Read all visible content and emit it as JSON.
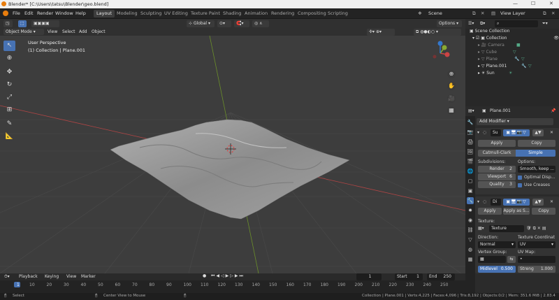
{
  "window": {
    "title": "Blender* [C:\\Users\\tatsu\\Blender\\geo.blend]",
    "min": "—",
    "max": "☐",
    "close": "✕"
  },
  "topbar": {
    "menus": [
      "File",
      "Edit",
      "Render",
      "Window",
      "Help"
    ],
    "workspaces": [
      "Layout",
      "Modeling",
      "Sculpting",
      "UV Editing",
      "Texture Paint",
      "Shading",
      "Animation",
      "Rendering",
      "Compositing",
      "Scripting"
    ],
    "active_workspace": "Layout",
    "scene": "Scene",
    "view_layer": "View Layer"
  },
  "viewport_header": {
    "mode": "Object Mode",
    "menus": [
      "View",
      "Select",
      "Add",
      "Object"
    ],
    "transform": "Global",
    "options": "Options"
  },
  "viewport": {
    "perspective": "User Perspective",
    "collection": "(1) Collection | Plane.001"
  },
  "outliner": {
    "rows": [
      {
        "label": "Scene Collection",
        "dim": false
      },
      {
        "label": "Collection",
        "dim": false
      },
      {
        "label": "Camera",
        "dim": true
      },
      {
        "label": "Cube",
        "dim": true
      },
      {
        "label": "Plane",
        "dim": true
      },
      {
        "label": "Plane.001",
        "dim": false
      },
      {
        "label": "Sun",
        "dim": false
      }
    ]
  },
  "properties": {
    "object_name": "Plane.001",
    "add_modifier": "Add Modifier",
    "subsurf": {
      "name": "Su",
      "apply": "Apply",
      "copy": "Copy",
      "catmull": "Catmull-Clark",
      "simple": "Simple",
      "subdivisions_label": "Subdivisions:",
      "options_label": "Options:",
      "render_label": "Render",
      "render_value": "2",
      "viewport_label": "Viewport",
      "viewport_value": "6",
      "quality_label": "Quality",
      "quality_value": "3",
      "uv_smooth": "Smooth, keep ...",
      "optimal": "Optimal Disp...",
      "use_creases": "Use Creases"
    },
    "displace": {
      "name": "Di",
      "apply": "Apply",
      "apply_shape": "Apply as S...",
      "copy": "Copy",
      "texture_label": "Texture:",
      "texture": "Texture",
      "direction_label": "Direction:",
      "texcoord_label": "Texture Coordinat",
      "direction": "Normal",
      "texcoord": "UV",
      "vgroup_label": "Vertex Group:",
      "uvmap_label": "UV Map:",
      "midlevel_label": "Midlevel",
      "midlevel": "0.500",
      "strength_label": "Streng",
      "strength": "1.000"
    }
  },
  "timeline": {
    "menus": [
      "Playback",
      "Keying",
      "View",
      "Marker"
    ],
    "current": "1",
    "start_label": "Start",
    "start": "1",
    "end_label": "End",
    "end": "250",
    "ruler": [
      "1",
      "10",
      "20",
      "30",
      "40",
      "50",
      "60",
      "70",
      "80",
      "90",
      "100",
      "110",
      "120",
      "130",
      "140",
      "150",
      "160",
      "170",
      "180",
      "190",
      "200",
      "210",
      "220",
      "230",
      "240",
      "250"
    ]
  },
  "status": {
    "select": "Select",
    "center": "Center View to Mouse",
    "stats": "Collection | Plane.001 | Verts:4,225 | Faces:4,096 | Tris:8,192 | Objects:0/2 | Mem: 351.6 MiB | 2.83.4"
  },
  "colors": {
    "accent": "#4772b3",
    "x_axis": "#b04545",
    "y_axis": "#6b8f2a",
    "terrain": "#9a9a9a"
  }
}
